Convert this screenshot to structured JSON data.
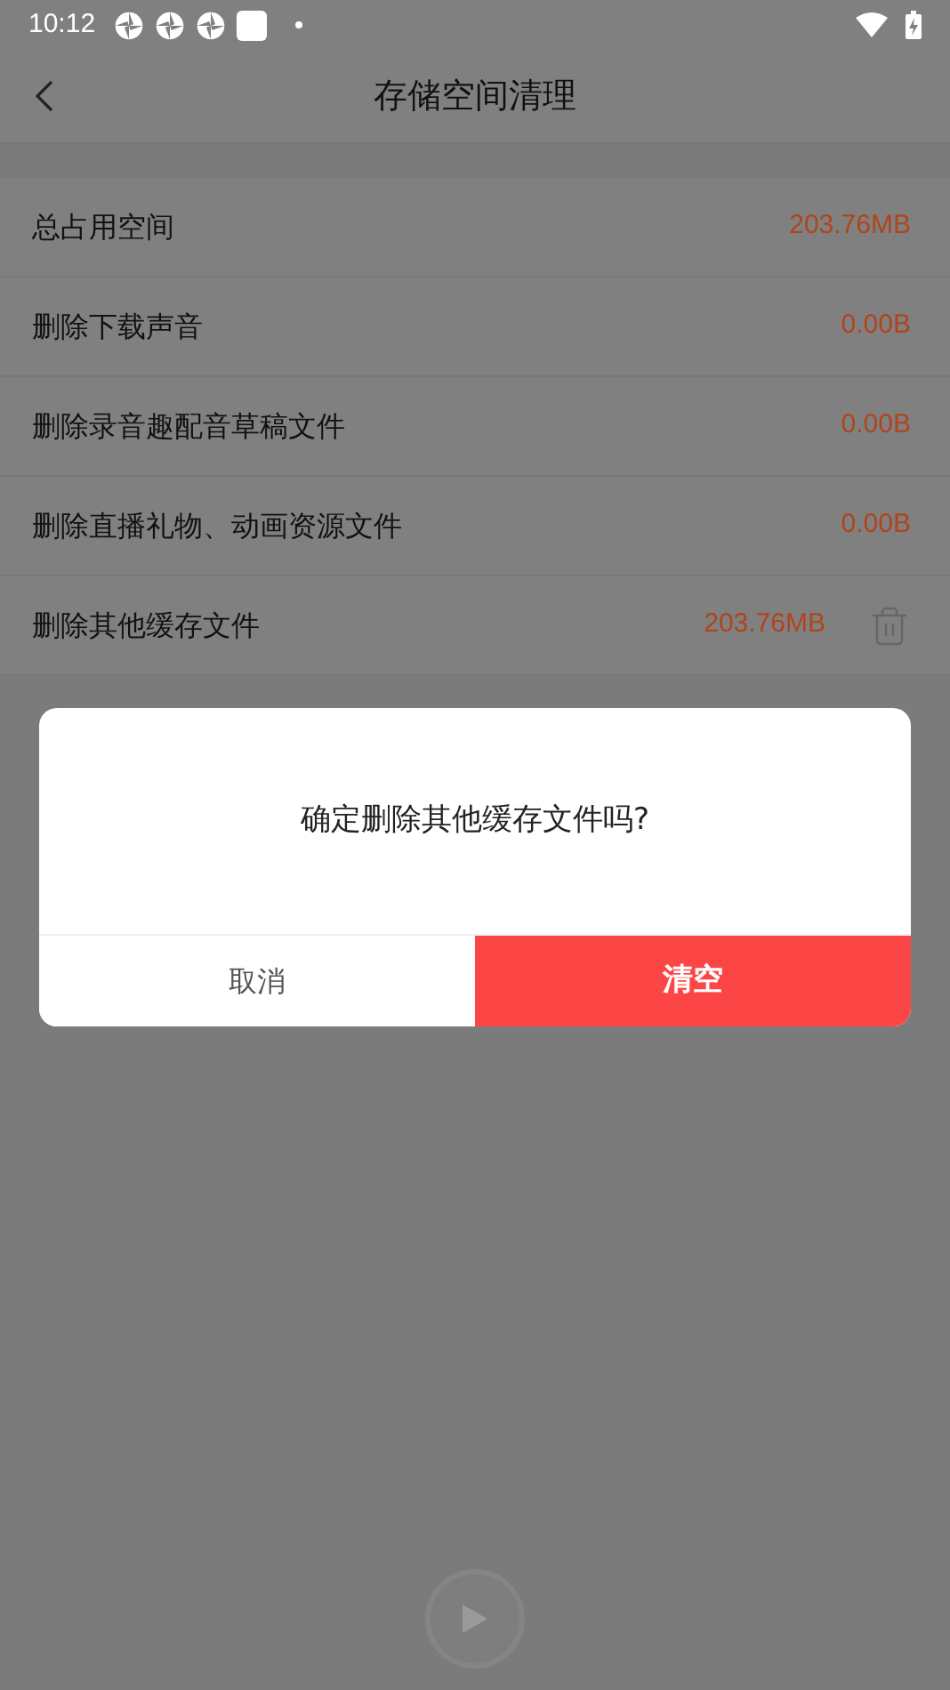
{
  "status_bar": {
    "time": "10:12"
  },
  "header": {
    "title": "存储空间清理"
  },
  "rows": [
    {
      "kind": "value",
      "label": "总占用空间",
      "value": "203.76MB"
    },
    {
      "kind": "value",
      "label": "删除下载声音",
      "value": "0.00B"
    },
    {
      "kind": "value",
      "label": "删除录音趣配音草稿文件",
      "value": "0.00B"
    },
    {
      "kind": "value",
      "label": "删除直播礼物、动画资源文件",
      "value": "0.00B"
    },
    {
      "kind": "trash",
      "label": "删除其他缓存文件",
      "value": "203.76MB"
    }
  ],
  "dialog": {
    "message": "确定删除其他缓存文件吗?",
    "cancel": "取消",
    "confirm": "清空"
  }
}
